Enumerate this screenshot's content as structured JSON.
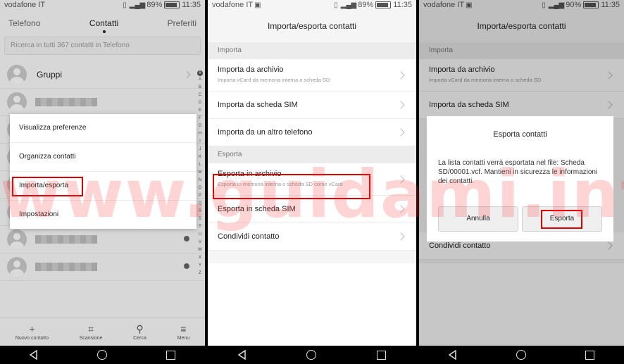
{
  "status": [
    {
      "carrier": "vodafone IT",
      "battery": "89%",
      "time": "11:35"
    },
    {
      "carrier": "vodafone IT",
      "battery": "89%",
      "time": "11:35"
    },
    {
      "carrier": "vodafone IT",
      "battery": "90%",
      "time": "11:35"
    }
  ],
  "contacts_screen": {
    "tabs": [
      "Telefono",
      "Contatti",
      "Preferiti"
    ],
    "search_placeholder": "Ricerca in tutti 367 contatti in Telefono",
    "groups_label": "Gruppi",
    "index_letters": [
      "A",
      "B",
      "C",
      "D",
      "E",
      "F",
      "G",
      "H",
      "I",
      "J",
      "K",
      "L",
      "M",
      "N",
      "O",
      "P",
      "Q",
      "R",
      "S",
      "T",
      "U",
      "V",
      "W",
      "X",
      "Y",
      "Z"
    ],
    "menu": [
      "Visualizza preferenze",
      "Organizza contatti",
      "Importa/esporta",
      "Impostazioni"
    ],
    "bottom_bar": [
      "Nuovo contatto",
      "Scansione",
      "Cerca",
      "Menu"
    ]
  },
  "import_export_screen": {
    "title": "Importa/esporta contatti",
    "section_import": "Importa",
    "import_items": [
      {
        "title": "Importa da archivio",
        "subtitle": "Importa vCard da memoria interna o scheda SD"
      },
      {
        "title": "Importa da scheda SIM",
        "subtitle": ""
      },
      {
        "title": "Importa da un altro telefono",
        "subtitle": ""
      }
    ],
    "section_export": "Esporta",
    "export_items": [
      {
        "title": "Esporta in archivio",
        "subtitle": "Esporta in memoria interna o scheda SD come vCard"
      },
      {
        "title": "Esporta in scheda SIM",
        "subtitle": ""
      },
      {
        "title": "Condividi contatto",
        "subtitle": ""
      }
    ]
  },
  "dialog_screen": {
    "title": "Importa/esporta contatti",
    "section_import": "Importa",
    "item_import_archive": "Importa da archivio",
    "item_import_archive_sub": "Importa vCard da memoria interna o scheda SD",
    "item_import_sim": "Importa da scheda SIM",
    "item_share": "Condividi contatto",
    "dialog": {
      "title": "Esporta contatti",
      "message": "La lista contatti verrà esportata nel file: Scheda SD/00001.vcf. Mantieni in sicurezza le informazioni dei contatti.",
      "cancel": "Annulla",
      "confirm": "Esporta"
    }
  },
  "watermark": "www.guidami.info",
  "highlight_color": "#e00000"
}
